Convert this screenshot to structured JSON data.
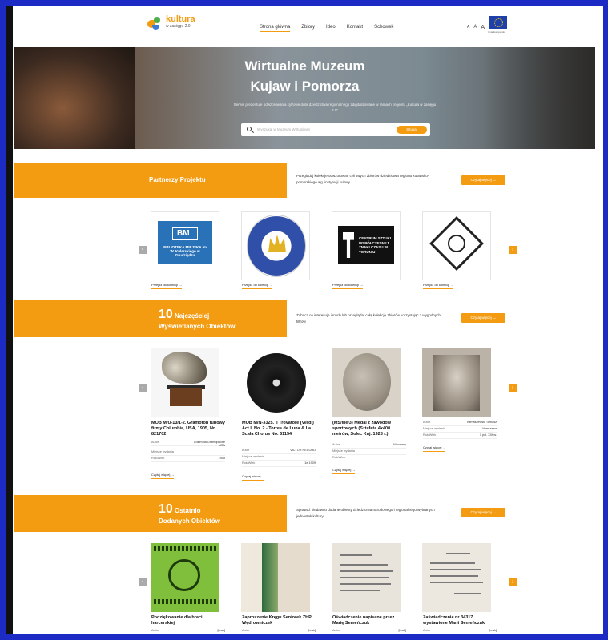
{
  "header": {
    "logo_main": "kultura",
    "logo_sub": "w zasięgu 2.0",
    "nav": [
      "Strona główna",
      "Zbiory",
      "Ideo",
      "Kontakt",
      "Schowek"
    ],
    "font_sizes": [
      "A",
      "A",
      "A"
    ],
    "eu_caption": "Unia Europejska"
  },
  "hero": {
    "title_line1": "Wirtualne Muzeum",
    "title_line2": "Kujaw i Pomorza",
    "subtitle": "Serwis prezentuje odwzorowania cyfrowe dóbr dziedzictwa regionalnego zdigitalizowane w ramach projektu „Kultura w zasięgu 2.0”",
    "search_placeholder": "Wyszukaj w Muzeum Wirtualnym",
    "search_button": "Szukaj"
  },
  "partners": {
    "heading": "Partnerzy Projektu",
    "description": "Przeglądaj kolekcje odwzorowań cyfrowych zbiorów dziedzictwa regionu kujawsko-pomorskiego wg. instytucji kultury",
    "more_label": "Czytaj więcej →",
    "cards": [
      {
        "logo_text": "BIBLIOTEKA MIEJSKA im. W. Kulerskiego w Grudziądzu",
        "link": "Przejdź do kolekcji →"
      },
      {
        "logo_text": "BIBLIOTEKA UNIWERSYTECKA W TORUNIU",
        "link": "Przejdź do kolekcji →"
      },
      {
        "logo_text": "CENTRUM SZTUKI WSPÓŁCZESNEJ ZNAKI CZASU W TORUNIU",
        "link": "Przejdź do kolekcji →"
      },
      {
        "logo_text": "",
        "link": "Przejdź do kolekcji →"
      }
    ]
  },
  "most_viewed": {
    "number": "10",
    "heading_a": "Najczęściej",
    "heading_b": "Wyświetlanych Obiektów",
    "description": "Zobacz co interesuje innych lub przeglądaj całą kolekcję zbiorów korzystając z wygodnych filtrów",
    "more_label": "Czytaj więcej →",
    "items": [
      {
        "title": "MOB M/U-13/1-2. Gramofon tubowy firmy Columbia, USA, 1905, Nr 821702",
        "meta": [
          [
            "Autor",
            "Columbia Gramophone USA"
          ],
          [
            "Miejsce wydania",
            ""
          ],
          [
            "Rok/Wiek",
            "1905"
          ]
        ],
        "read": "Czytaj więcej →"
      },
      {
        "title": "MOB M/N-3325. Il Trovatore (Verdi) Act I. No. 2 - Torres de Luna & La Scala Chorus No. 61154",
        "meta": [
          [
            "Autor",
            "VICTOR RECORD"
          ],
          [
            "Miejsce wydania",
            ""
          ],
          [
            "Rok/Wiek",
            "1e 1909"
          ]
        ],
        "read": "Czytaj więcej →"
      },
      {
        "title": "(MS/Me/3) Medal z zawodów sportowych (Sztafeta 4x400 metrów, Solec Kuj. 1928 r.)",
        "meta": [
          [
            "Autor",
            "Nieznany"
          ],
          [
            "Miejsce wydania",
            ""
          ],
          [
            "Rok/Wiek",
            ""
          ]
        ],
        "read": "Czytaj więcej →"
      },
      {
        "title": "",
        "meta": [
          [
            "Autor",
            "Kłimaszewski Tomasz"
          ],
          [
            "Miejsce wydania",
            "Warszawa"
          ],
          [
            "Rok/Wiek",
            "1 poł. XIX w."
          ]
        ],
        "read": "Czytaj więcej →"
      }
    ]
  },
  "last_added": {
    "number": "10",
    "heading_a": "Ostatnio",
    "heading_b": "Dodanych Obiektów",
    "description": "Sprawdź niedawno dodane obiekty dziedzictwa narodowego i regionalnego wybranych jednostek kultury",
    "more_label": "Czytaj więcej →",
    "items": [
      {
        "title": "Podziękowanie dla braci harcerskiej",
        "author_label": "Autor",
        "author": "[brak]"
      },
      {
        "title": "Zaproszenie Kręgu Seniorek ZHP Wędrowniczek",
        "author_label": "Autor",
        "author": "[brak]"
      },
      {
        "title": "Oświadczenie napisane przez Marię Semeńczuk",
        "author_label": "Autor",
        "author": "[brak]"
      },
      {
        "title": "Zaświadczenie nr 34317 wystawione Marii Semeńczuk",
        "author_label": "Autor",
        "author": "[brak]"
      }
    ]
  },
  "arrows": {
    "prev": "‹",
    "next": "›"
  },
  "colors": {
    "accent": "#f39c12",
    "frame": "#1c2bc4"
  }
}
